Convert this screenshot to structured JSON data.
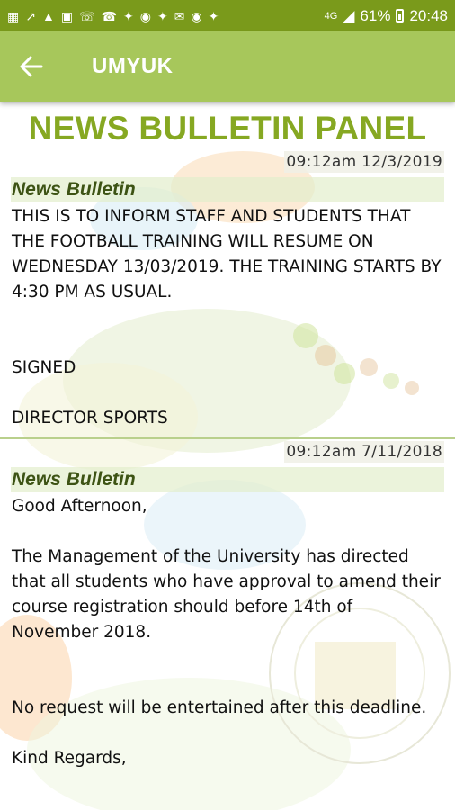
{
  "status_bar": {
    "battery": "61%",
    "time": "20:48",
    "signal": "4G"
  },
  "app_bar": {
    "title": "UMYUK"
  },
  "panel": {
    "title": "NEWS BULLETIN PANEL"
  },
  "bulletins": [
    {
      "timestamp": "09:12am  12/3/2019",
      "heading": "News Bulletin",
      "body": "THIS IS TO INFORM STAFF AND STUDENTS THAT THE FOOTBALL TRAINING WILL RESUME ON WEDNESDAY 13/03/2019. THE TRAINING STARTS BY 4:30 PM AS USUAL.\n\n\nSIGNED\n\nDIRECTOR SPORTS"
    },
    {
      "timestamp": "09:12am  7/11/2018",
      "heading": "News Bulletin",
      "body": "Good Afternoon,\n\nThe Management of the University has directed that all students who have approval to amend their course registration should before 14th of November 2018.\n\n\nNo request will be entertained after this deadline.\n\nKind Regards,"
    }
  ],
  "colors": {
    "status_bar": "#7a9a1b",
    "app_bar": "#a7c75b",
    "title_green": "#86a822"
  }
}
